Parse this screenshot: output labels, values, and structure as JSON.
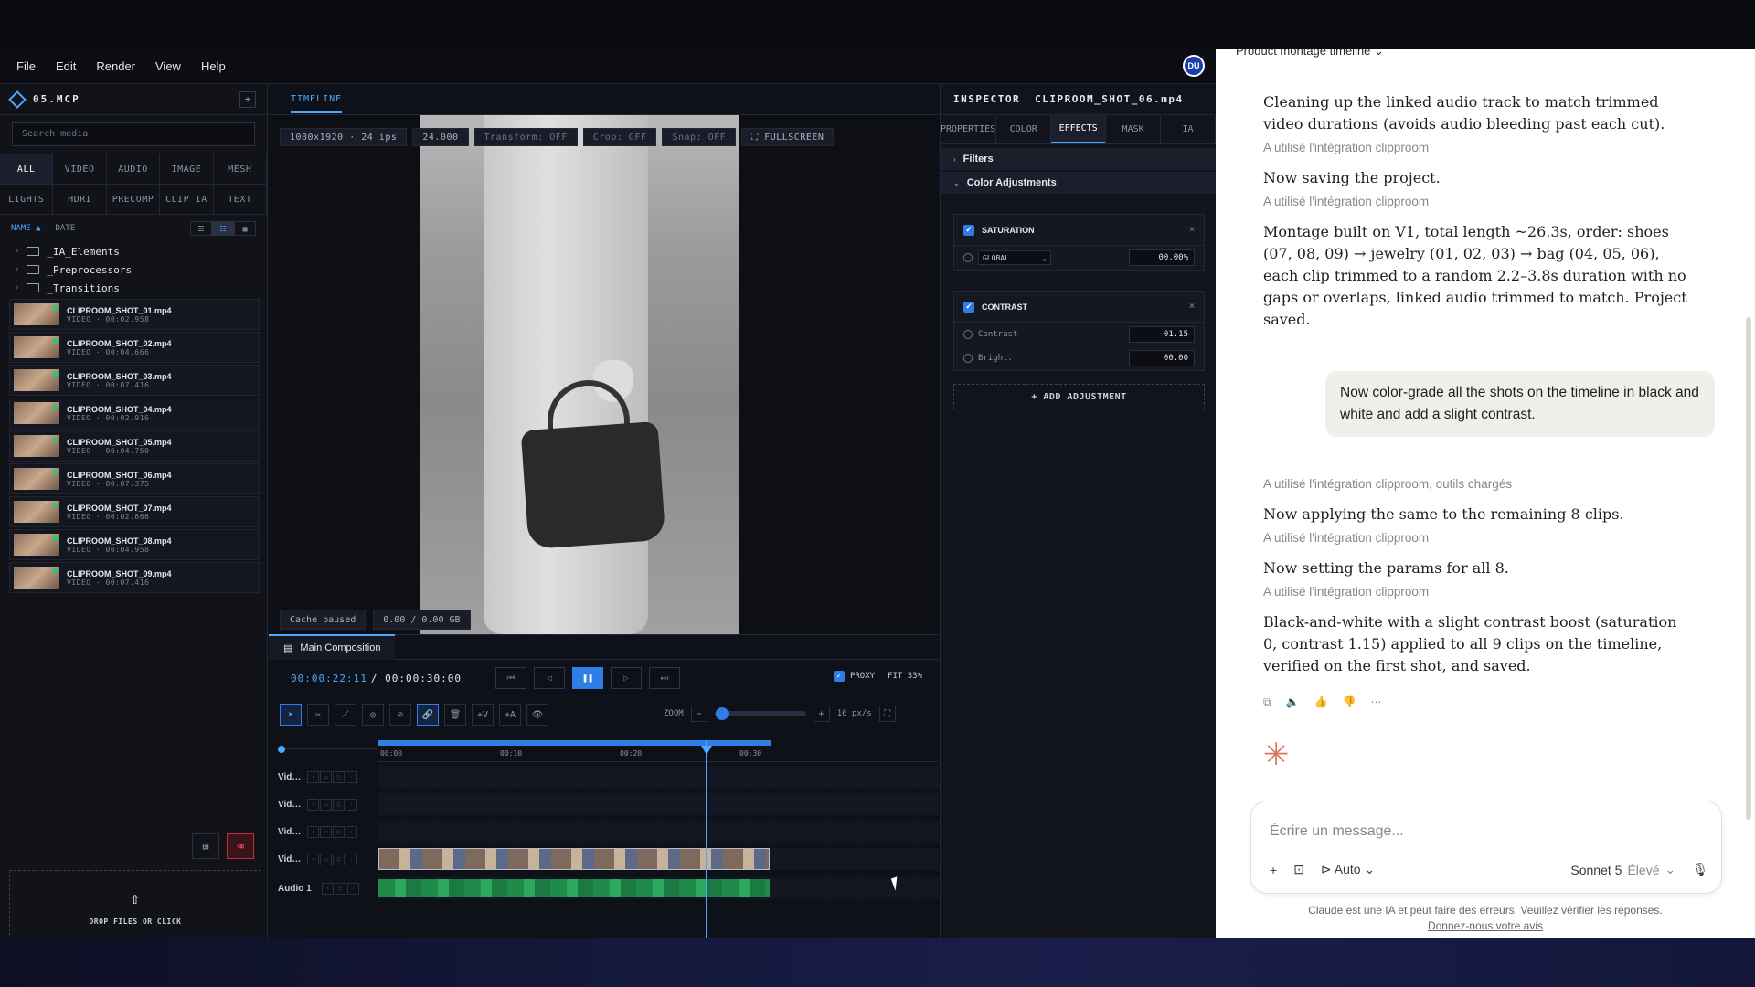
{
  "menu": {
    "file": "File",
    "edit": "Edit",
    "render": "Render",
    "view": "View",
    "help": "Help",
    "avatar": "DU"
  },
  "left": {
    "project": "05.MCP",
    "add": "+",
    "search_placeholder": "Search media",
    "tabs1": [
      "ALL",
      "VIDEO",
      "AUDIO",
      "IMAGE",
      "MESH"
    ],
    "tabs2": [
      "LIGHTS",
      "HDRI",
      "PRECOMP",
      "CLIP IA",
      "TEXT"
    ],
    "sort_name": "NAME ▲",
    "sort_date": "DATE",
    "folders": [
      "_IA_Elements",
      "_Preprocessors",
      "_Transitions"
    ],
    "clips": [
      {
        "name": "CLIPROOM_SHOT_01.mp4",
        "meta": "VIDEO · 00:02.958"
      },
      {
        "name": "CLIPROOM_SHOT_02.mp4",
        "meta": "VIDEO · 00:04.666"
      },
      {
        "name": "CLIPROOM_SHOT_03.mp4",
        "meta": "VIDEO · 00:07.416"
      },
      {
        "name": "CLIPROOM_SHOT_04.mp4",
        "meta": "VIDEO · 00:02.916"
      },
      {
        "name": "CLIPROOM_SHOT_05.mp4",
        "meta": "VIDEO · 00:04.750"
      },
      {
        "name": "CLIPROOM_SHOT_06.mp4",
        "meta": "VIDEO · 00:07.375"
      },
      {
        "name": "CLIPROOM_SHOT_07.mp4",
        "meta": "VIDEO · 00:02.666"
      },
      {
        "name": "CLIPROOM_SHOT_08.mp4",
        "meta": "VIDEO · 00:04.958"
      },
      {
        "name": "CLIPROOM_SHOT_09.mp4",
        "meta": "VIDEO · 00:07.416"
      }
    ],
    "drop": "DROP FILES OR CLICK"
  },
  "center": {
    "tab": "TIMELINE",
    "viewer_bar": [
      "1080x1920 · 24 ips",
      "24.000",
      "Transform: OFF",
      "Crop: OFF",
      "Snap: OFF",
      "⛶ FULLSCREEN"
    ],
    "cache": "Cache paused",
    "cache_size": "0.00 / 0.00 GB",
    "comp_tab": "Main Composition",
    "timecode": "00:00:22:11",
    "duration": "/ 00:00:30:00",
    "proxy": "PROXY",
    "fit": "FIT 33%",
    "zoom_label": "ZOOM",
    "zoom_value": "16 px/s",
    "zoom_level": 0.05,
    "ruler": [
      "00:00",
      "00:10",
      "00:20",
      "00:30"
    ],
    "tracks": [
      "Vid…",
      "Vid…",
      "Vid…",
      "Vid…",
      "Audio 1"
    ]
  },
  "inspector": {
    "title": "INSPECTOR",
    "clip": "CLIPROOM_SHOT_06.mp4",
    "tabs": [
      "PROPERTIES",
      "COLOR",
      "EFFECTS",
      "MASK",
      "IA"
    ],
    "filters": "Filters",
    "color_adj": "Color Adjustments",
    "saturation": {
      "title": "SATURATION",
      "scope": "GLOBAL",
      "value": "00.00%"
    },
    "contrast": {
      "title": "CONTRAST",
      "contrast_label": "Contrast",
      "contrast_value": "01.15",
      "bright_label": "Bright.",
      "bright_value": "00.00"
    },
    "add": "+ ADD ADJUSTMENT"
  },
  "claude": {
    "title": "Product montage timeline",
    "m1": "Cleaning up the linked audio track to match trimmed video durations (avoids audio bleeding past each cut).",
    "t1": "A utilisé l'intégration clipproom",
    "m2": "Now saving the project.",
    "t2": "A utilisé l'intégration clipproom",
    "m3": "Montage built on V1, total length ~26.3s, order: shoes (07, 08, 09) → jewelry (01, 02, 03) → bag (04, 05, 06), each clip trimmed to a random 2.2–3.8s duration with no gaps or overlaps, linked audio trimmed to match. Project saved.",
    "user": "Now color-grade all the shots on the timeline in black and white and add a slight contrast.",
    "t3": "A utilisé l'intégration clipproom, outils chargés",
    "m4": "Now applying the same to the remaining 8 clips.",
    "t4": "A utilisé l'intégration clipproom",
    "m5": "Now setting the params for all 8.",
    "t5": "A utilisé l'intégration clipproom",
    "m6": "Black-and-white with a slight contrast boost (saturation 0, contrast 1.15) applied to all 9 clips on the timeline, verified on the first shot, and saved.",
    "placeholder": "Écrire un message...",
    "auto": "Auto",
    "model": "Sonnet 5",
    "effort": "Élevé",
    "disclaimer": "Claude est une IA et peut faire des erreurs. Veuillez vérifier les réponses.",
    "feedback": "Donnez-nous votre avis"
  }
}
